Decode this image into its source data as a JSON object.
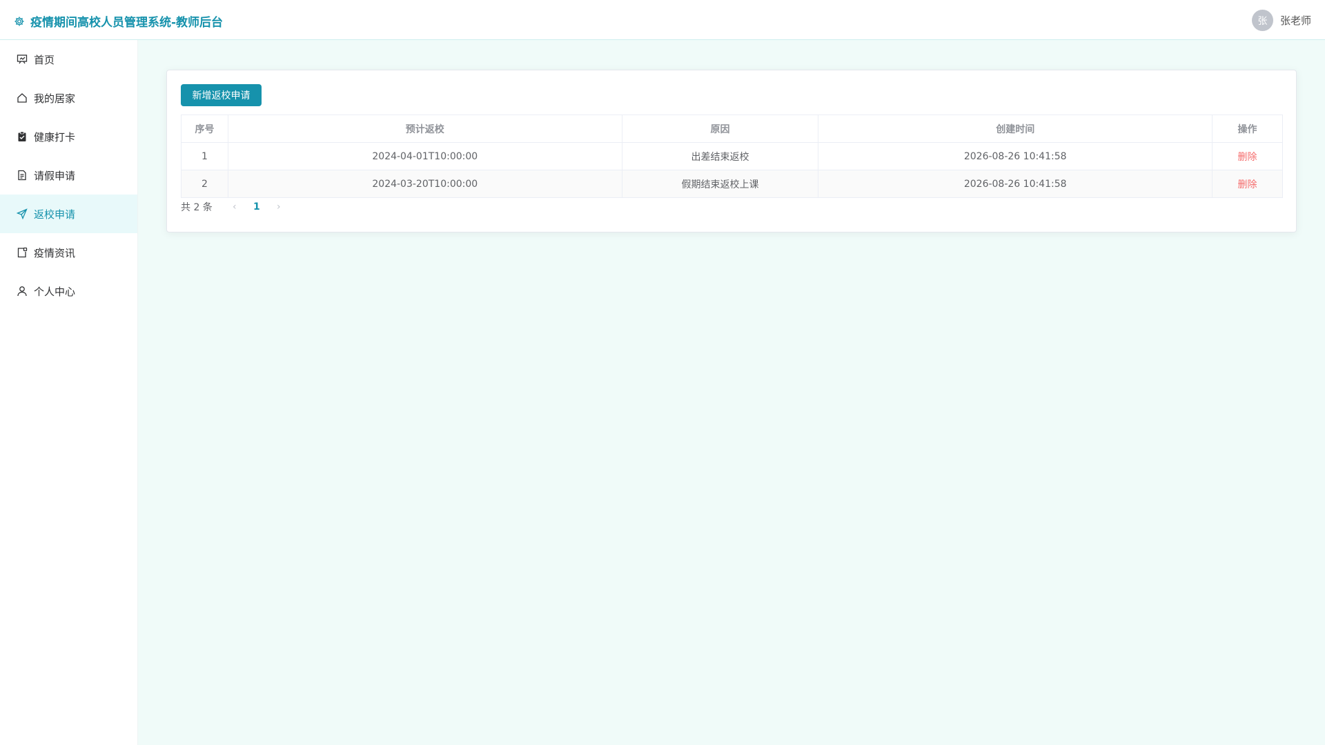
{
  "header": {
    "title": "疫情期间高校人员管理系统-教师后台",
    "user_avatar": "张",
    "user_name": "张老师"
  },
  "sidebar": {
    "items": [
      {
        "label": "首页",
        "icon": "presentation-icon"
      },
      {
        "label": "我的居家",
        "icon": "house-icon"
      },
      {
        "label": "健康打卡",
        "icon": "clipboard-check-icon"
      },
      {
        "label": "请假申请",
        "icon": "document-icon"
      },
      {
        "label": "返校申请",
        "icon": "send-icon",
        "active": true
      },
      {
        "label": "疫情资讯",
        "icon": "news-icon"
      },
      {
        "label": "个人中心",
        "icon": "user-icon"
      }
    ]
  },
  "main": {
    "add_button": "新增返校申请",
    "table": {
      "headers": [
        "序号",
        "预计返校",
        "原因",
        "创建时间",
        "操作"
      ],
      "rows": [
        {
          "index": "1",
          "expected": "2024-04-01T10:00:00",
          "reason": "出差结束返校",
          "created": "2026-08-26 10:41:58",
          "action": "删除"
        },
        {
          "index": "2",
          "expected": "2024-03-20T10:00:00",
          "reason": "假期结束返校上课",
          "created": "2026-08-26 10:41:58",
          "action": "删除"
        }
      ]
    },
    "pagination": {
      "total": "共 2 条",
      "current_page": "1"
    }
  },
  "colors": {
    "accent": "#1692ac",
    "danger": "#f56c6c",
    "background": "#f0fbf9"
  }
}
